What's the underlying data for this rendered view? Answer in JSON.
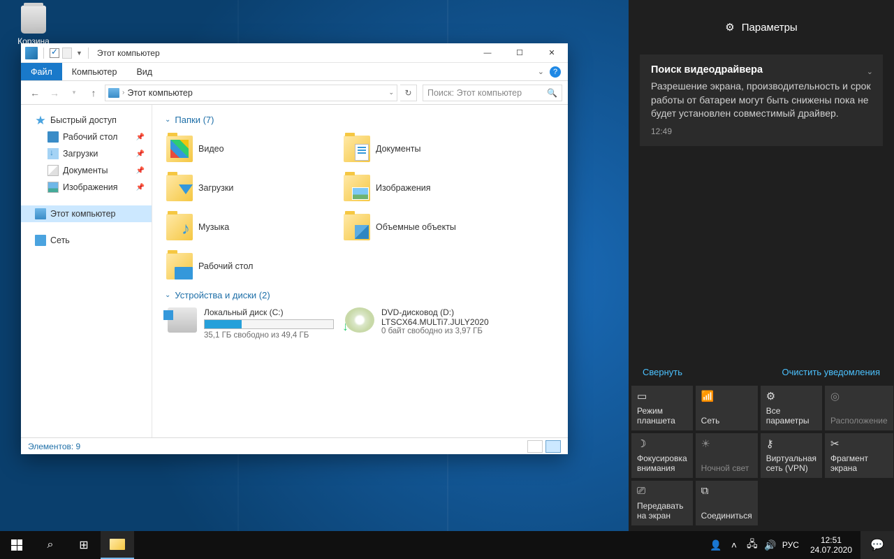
{
  "desktop": {
    "recycle_bin": "Корзина"
  },
  "explorer": {
    "title": "Этот компьютер",
    "tabs": {
      "file": "Файл",
      "computer": "Компьютер",
      "view": "Вид"
    },
    "address": {
      "location": "Этот компьютер",
      "sep": "›"
    },
    "search_placeholder": "Поиск: Этот компьютер",
    "nav": {
      "quick_access": "Быстрый доступ",
      "desktop": "Рабочий стол",
      "downloads": "Загрузки",
      "documents": "Документы",
      "pictures": "Изображения",
      "this_pc": "Этот компьютер",
      "network": "Сеть"
    },
    "groups": {
      "folders": "Папки (7)",
      "drives": "Устройства и диски (2)"
    },
    "folders": {
      "videos": "Видео",
      "documents": "Документы",
      "downloads": "Загрузки",
      "pictures": "Изображения",
      "music": "Музыка",
      "objects3d": "Объемные объекты",
      "desktop": "Рабочий стол"
    },
    "drives": {
      "c": {
        "name": "Локальный диск (C:)",
        "free": "35,1 ГБ свободно из 49,4 ГБ",
        "fill_percent": 29
      },
      "d": {
        "name": "DVD-дисковод (D:)",
        "label": "LTSCX64.MULTi7.JULY2020",
        "free": "0 байт свободно из 3,97 ГБ"
      }
    },
    "status": "Элементов: 9"
  },
  "action_center": {
    "header": "Параметры",
    "notification": {
      "title": "Поиск видеодрайвера",
      "body": "Разрешение экрана, производительность и срок работы от батареи могут быть снижены пока не будет установлен совместимый драйвер.",
      "time": "12:49"
    },
    "collapse": "Свернуть",
    "clear": "Очистить уведомления",
    "tiles": [
      {
        "icon": "▭",
        "label": "Режим планшета"
      },
      {
        "icon": "📶",
        "label": "Сеть"
      },
      {
        "icon": "⚙",
        "label": "Все параметры"
      },
      {
        "icon": "◎",
        "label": "Расположение",
        "dim": true
      },
      {
        "icon": "☽",
        "label": "Фокусировка внимания"
      },
      {
        "icon": "☀",
        "label": "Ночной свет",
        "dim": true
      },
      {
        "icon": "⚷",
        "label": "Виртуальная сеть (VPN)"
      },
      {
        "icon": "✂",
        "label": "Фрагмент экрана"
      },
      {
        "icon": "⎚",
        "label": "Передавать на экран"
      },
      {
        "icon": "⧉",
        "label": "Соединиться"
      }
    ]
  },
  "taskbar": {
    "lang": "РУС",
    "time": "12:51",
    "date": "24.07.2020"
  }
}
